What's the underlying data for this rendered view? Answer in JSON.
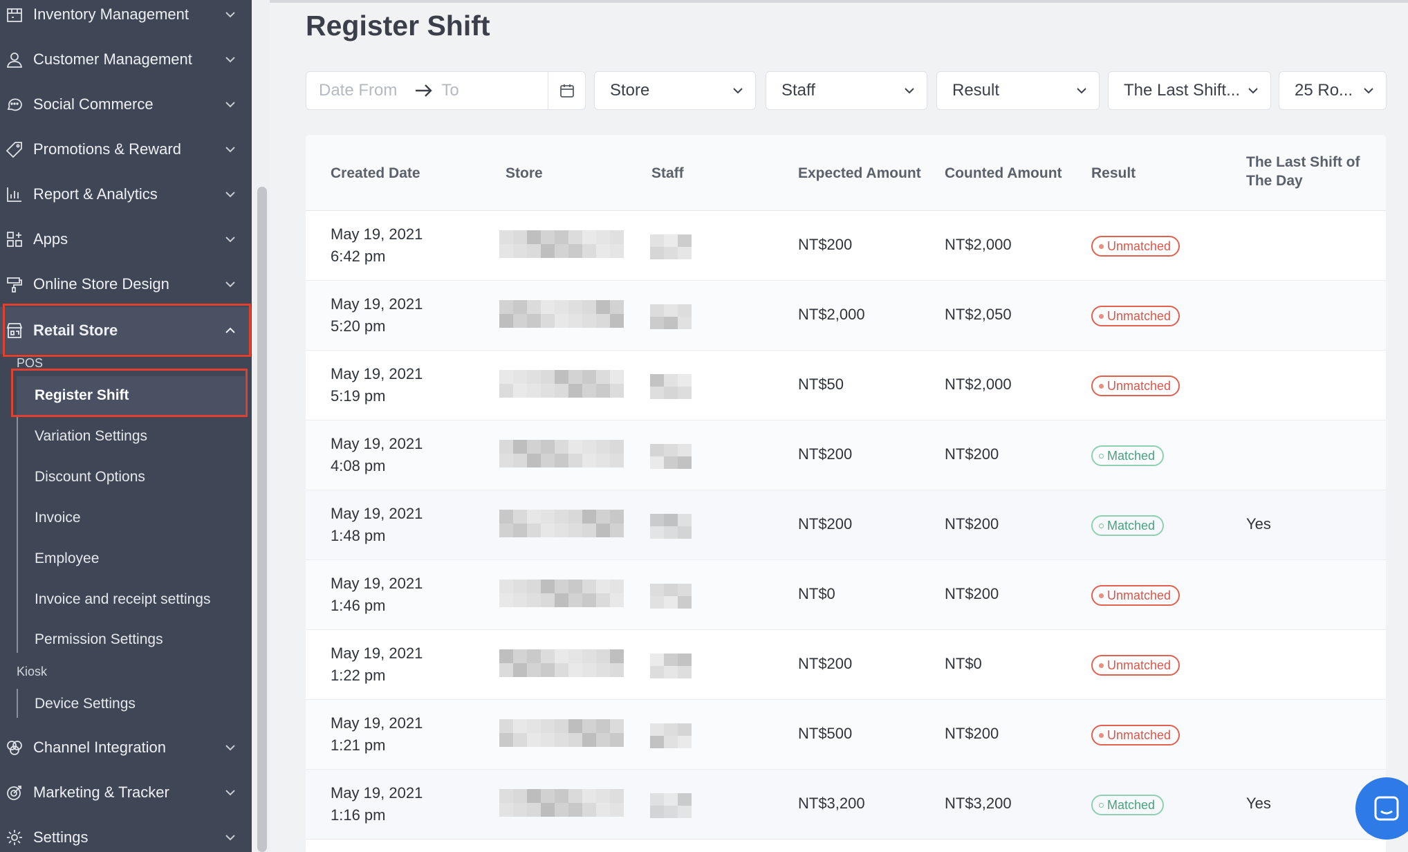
{
  "sidebar": {
    "items_top": [
      {
        "label": "Inventory Management",
        "icon": "inventory-icon"
      },
      {
        "label": "Customer Management",
        "icon": "customer-icon"
      },
      {
        "label": "Social Commerce",
        "icon": "chat-bubble-icon"
      },
      {
        "label": "Promotions & Reward",
        "icon": "tag-icon"
      },
      {
        "label": "Report & Analytics",
        "icon": "bar-chart-icon"
      },
      {
        "label": "Apps",
        "icon": "apps-grid-icon"
      },
      {
        "label": "Online Store Design",
        "icon": "paint-roller-icon"
      },
      {
        "label": "Retail Store",
        "icon": "store-icon"
      }
    ],
    "pos_label": "POS",
    "pos_items": [
      "Register Shift",
      "Variation Settings",
      "Discount Options",
      "Invoice",
      "Employee",
      "Invoice and receipt settings",
      "Permission Settings"
    ],
    "kiosk_label": "Kiosk",
    "kiosk_items": [
      "Device Settings"
    ],
    "items_bottom": [
      {
        "label": "Channel Integration",
        "icon": "channel-icon"
      },
      {
        "label": "Marketing & Tracker",
        "icon": "target-icon"
      },
      {
        "label": "Settings",
        "icon": "gear-icon"
      }
    ]
  },
  "page": {
    "title": "Register Shift"
  },
  "filters": {
    "date_from": "Date From",
    "date_to": "To",
    "store": "Store",
    "staff": "Staff",
    "result": "Result",
    "last_shift": "The Last Shift...",
    "rows": "25 Ro..."
  },
  "table": {
    "headers": {
      "created_date": "Created Date",
      "store": "Store",
      "staff": "Staff",
      "expected": "Expected Amount",
      "counted": "Counted Amount",
      "result": "Result",
      "last_shift_1": "The Last Shift of",
      "last_shift_2": "The Day"
    },
    "rows": [
      {
        "date": "May 19, 2021",
        "time": "6:42 pm",
        "expected": "NT$200",
        "counted": "NT$2,000",
        "result": "Unmatched",
        "last": ""
      },
      {
        "date": "May 19, 2021",
        "time": "5:20 pm",
        "expected": "NT$2,000",
        "counted": "NT$2,050",
        "result": "Unmatched",
        "last": ""
      },
      {
        "date": "May 19, 2021",
        "time": "5:19 pm",
        "expected": "NT$50",
        "counted": "NT$2,000",
        "result": "Unmatched",
        "last": ""
      },
      {
        "date": "May 19, 2021",
        "time": "4:08 pm",
        "expected": "NT$200",
        "counted": "NT$200",
        "result": "Matched",
        "last": ""
      },
      {
        "date": "May 19, 2021",
        "time": "1:48 pm",
        "expected": "NT$200",
        "counted": "NT$200",
        "result": "Matched",
        "last": "Yes"
      },
      {
        "date": "May 19, 2021",
        "time": "1:46 pm",
        "expected": "NT$0",
        "counted": "NT$200",
        "result": "Unmatched",
        "last": ""
      },
      {
        "date": "May 19, 2021",
        "time": "1:22 pm",
        "expected": "NT$200",
        "counted": "NT$0",
        "result": "Unmatched",
        "last": ""
      },
      {
        "date": "May 19, 2021",
        "time": "1:21 pm",
        "expected": "NT$500",
        "counted": "NT$200",
        "result": "Unmatched",
        "last": ""
      },
      {
        "date": "May 19, 2021",
        "time": "1:16 pm",
        "expected": "NT$3,200",
        "counted": "NT$3,200",
        "result": "Matched",
        "last": "Yes"
      }
    ]
  },
  "colors": {
    "sidebar_bg": "#3f4656",
    "highlight": "#e0402d",
    "unmatched": "#d9574a",
    "matched": "#48a27c",
    "chat": "#2e7ae6"
  }
}
